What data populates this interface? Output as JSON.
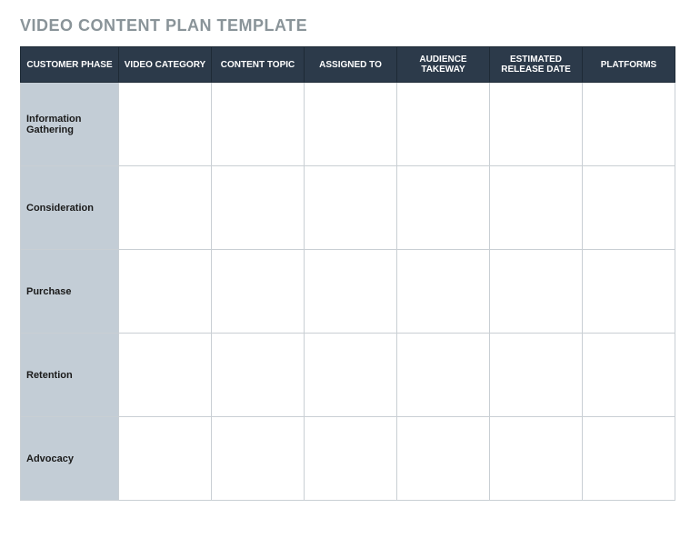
{
  "title": "VIDEO CONTENT PLAN TEMPLATE",
  "columns": {
    "phase": "CUSTOMER PHASE",
    "category": "VIDEO CATEGORY",
    "topic": "CONTENT TOPIC",
    "assigned": "ASSIGNED TO",
    "takeaway": "AUDIENCE TAKEWAY",
    "release": "ESTIMATED RELEASE DATE",
    "platforms": "PLATFORMS"
  },
  "rows": [
    {
      "phase": "Information Gathering",
      "category": "",
      "topic": "",
      "assigned": "",
      "takeaway": "",
      "release": "",
      "platforms": ""
    },
    {
      "phase": "Consideration",
      "category": "",
      "topic": "",
      "assigned": "",
      "takeaway": "",
      "release": "",
      "platforms": ""
    },
    {
      "phase": "Purchase",
      "category": "",
      "topic": "",
      "assigned": "",
      "takeaway": "",
      "release": "",
      "platforms": ""
    },
    {
      "phase": "Retention",
      "category": "",
      "topic": "",
      "assigned": "",
      "takeaway": "",
      "release": "",
      "platforms": ""
    },
    {
      "phase": "Advocacy",
      "category": "",
      "topic": "",
      "assigned": "",
      "takeaway": "",
      "release": "",
      "platforms": ""
    }
  ]
}
